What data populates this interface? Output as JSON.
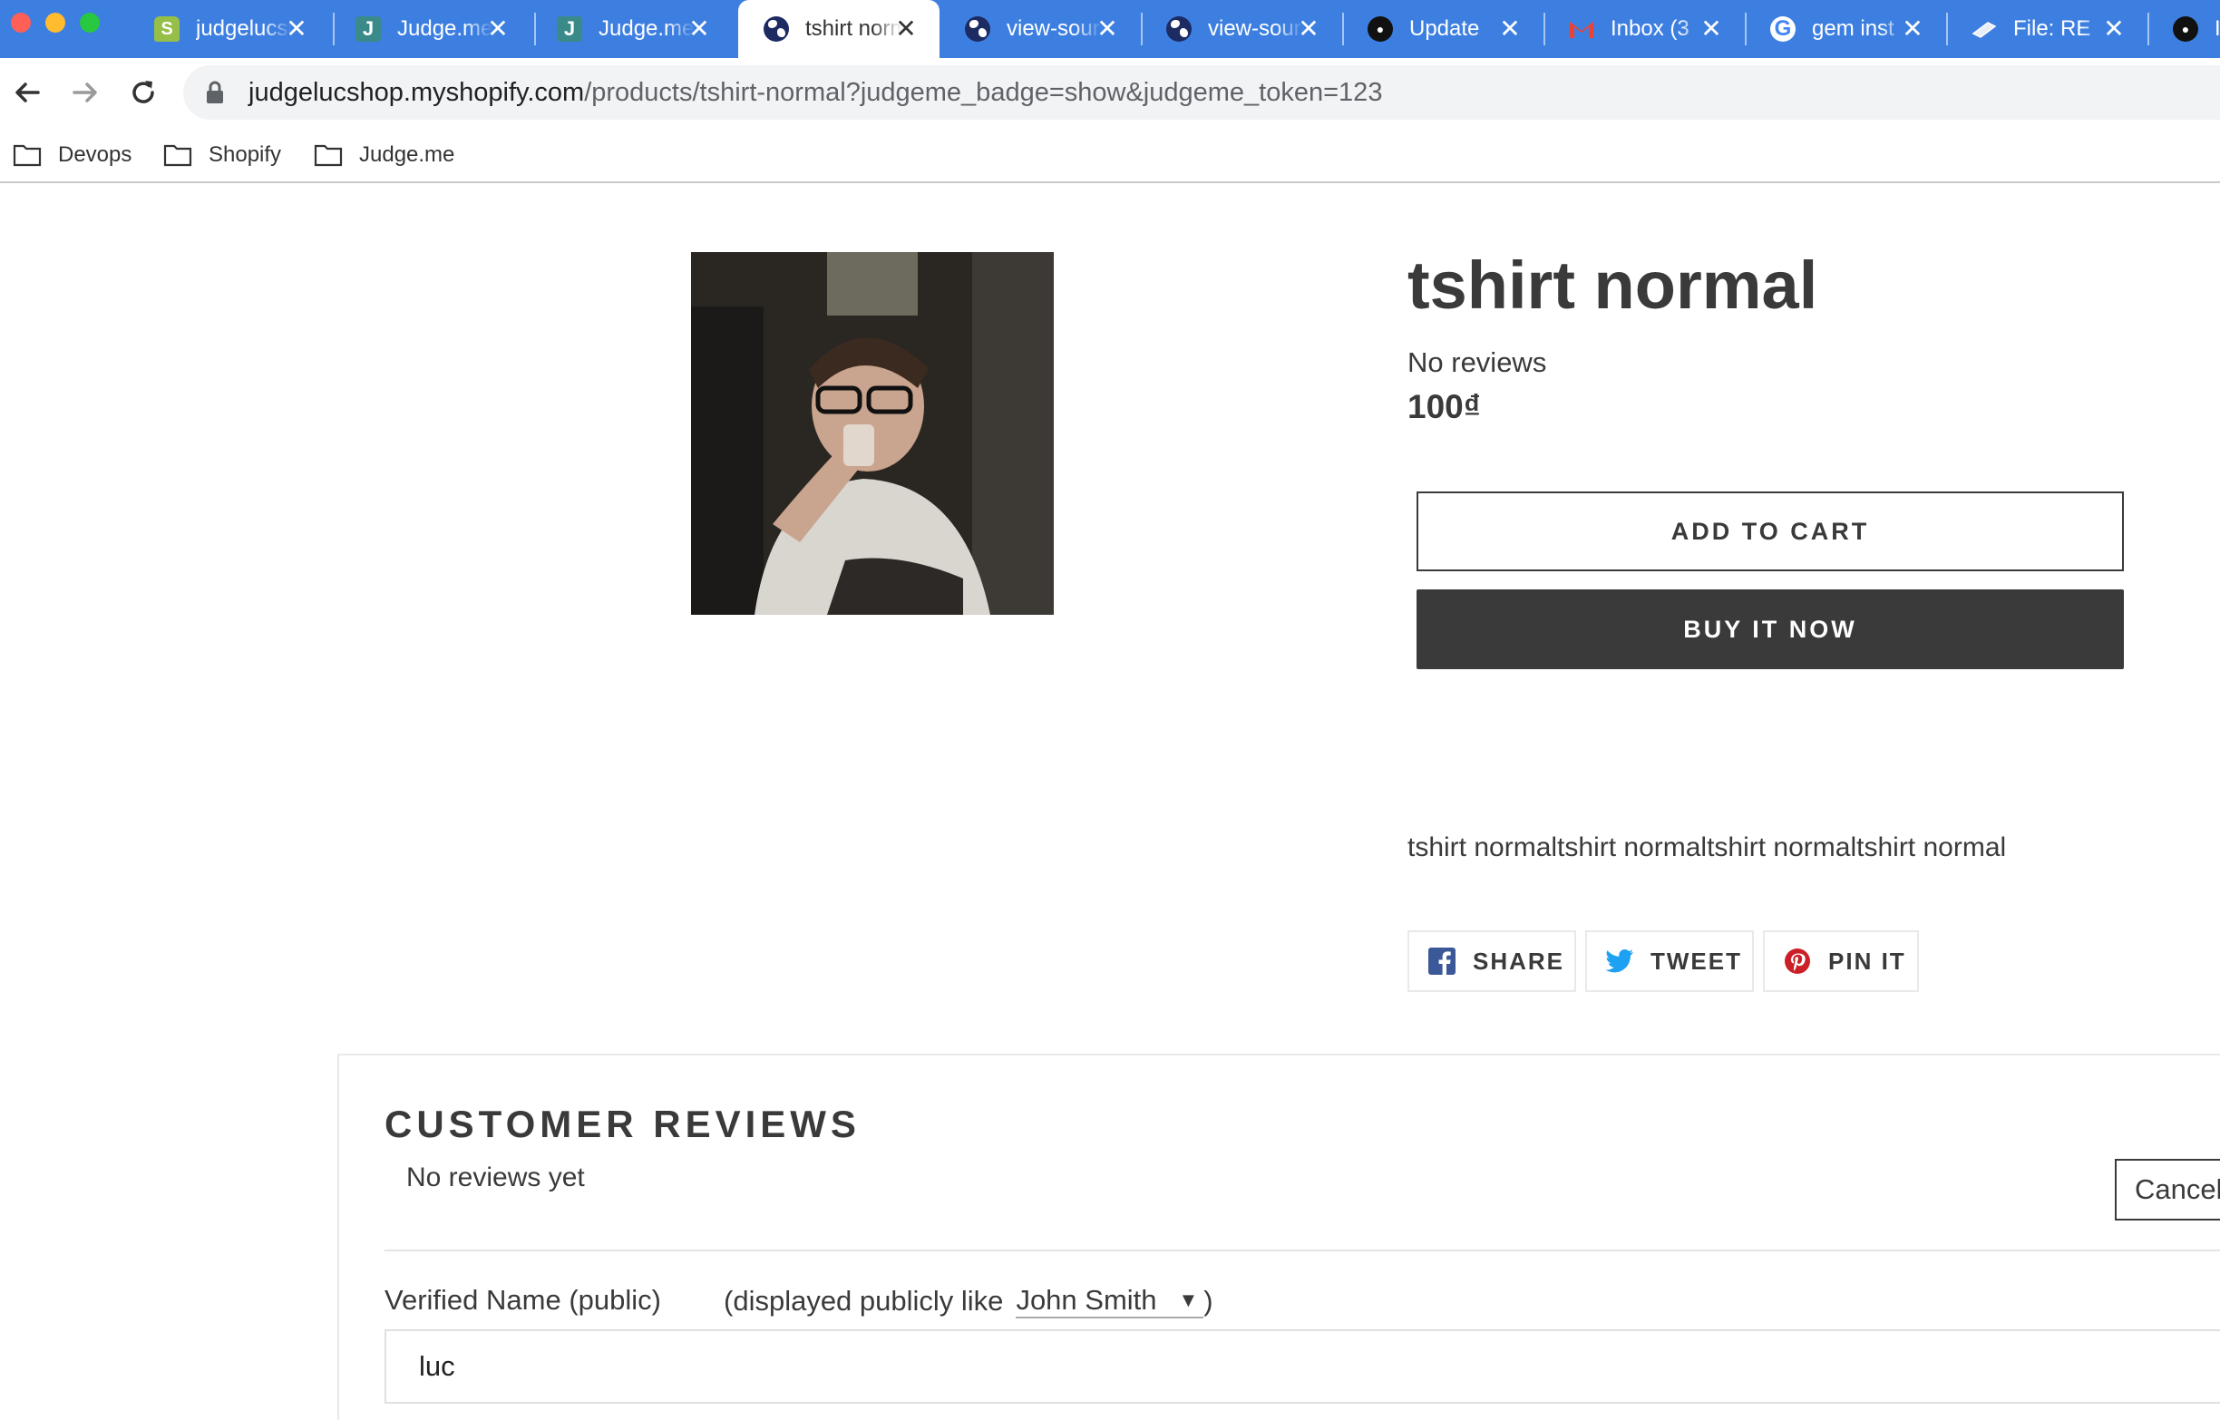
{
  "browser": {
    "tabs": [
      {
        "title": "judgelucshop",
        "favicon": "shopify-icon",
        "active": false
      },
      {
        "title": "Judge.me",
        "favicon": "judgeme-icon",
        "active": false
      },
      {
        "title": "Judge.me",
        "favicon": "judgeme-icon",
        "active": false
      },
      {
        "title": "tshirt normal",
        "favicon": "globe-icon",
        "active": true
      },
      {
        "title": "view-source",
        "favicon": "globe-icon",
        "active": false
      },
      {
        "title": "view-source",
        "favicon": "globe-icon",
        "active": false
      },
      {
        "title": "Update",
        "favicon": "github-icon",
        "active": false
      },
      {
        "title": "Inbox (3",
        "favicon": "gmail-icon",
        "active": false
      },
      {
        "title": "gem inst",
        "favicon": "google-icon",
        "active": false
      },
      {
        "title": "File: RE",
        "favicon": "file-icon",
        "active": false
      },
      {
        "title": "I",
        "favicon": "github-icon",
        "active": false
      }
    ],
    "url_host": "judgelucshop.myshopify.com",
    "url_path": "/products/tshirt-normal?judgeme_badge=show&judgeme_token=123",
    "bookmarks": [
      "Devops",
      "Shopify",
      "Judge.me"
    ]
  },
  "product": {
    "title": "tshirt normal",
    "reviews_summary": "No reviews",
    "price": "100₫",
    "add_to_cart_label": "ADD TO CART",
    "buy_now_label": "BUY IT NOW",
    "description": "tshirt normaltshirt normaltshirt normaltshirt normal"
  },
  "social": {
    "share": "SHARE",
    "tweet": "TWEET",
    "pin": "PIN IT"
  },
  "reviews": {
    "heading": "CUSTOMER REVIEWS",
    "empty_text": "No reviews yet",
    "cancel_label": "Cancel",
    "name_label": "Verified Name (public)",
    "hint_prefix": "(displayed publicly like",
    "name_format_selected": "John Smith",
    "hint_suffix": ")",
    "name_value": "luc"
  },
  "colors": {
    "tabbar": "#3d7fe0",
    "text": "#3a3a3a",
    "facebook": "#3b5998",
    "twitter": "#1da1f2",
    "pinterest": "#cb2027"
  }
}
